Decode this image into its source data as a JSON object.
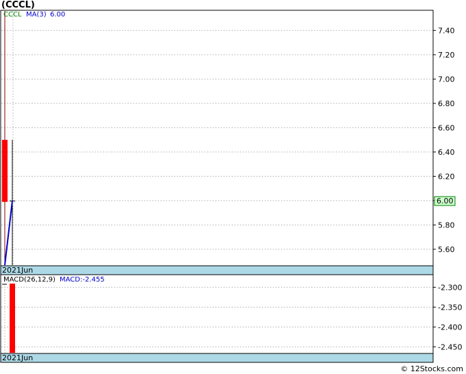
{
  "header": {
    "title": "(CCCL)"
  },
  "footer": {
    "credit": "© 12Stocks.com"
  },
  "colors": {
    "candle_down": "#ff0000",
    "ma_line": "#0000cc",
    "ticker_label": "#008000",
    "ma_label": "#0000cc",
    "macd_label": "#0000cc",
    "axis_band": "#add8e6",
    "grid": "#c0c0c0",
    "last_price_box": "#ccffcc"
  },
  "chart_data": [
    {
      "type": "candlestick",
      "legend": {
        "ticker": "CCCL",
        "ma_label": "MA(3)",
        "ma_value": "6.00"
      },
      "x_label": "2021Jun",
      "ylim": [
        5.47,
        7.56
      ],
      "y_ticks": [
        "5.60",
        "5.80",
        "6.00",
        "6.20",
        "6.40",
        "6.60",
        "6.80",
        "7.00",
        "7.20",
        "7.40"
      ],
      "grid": true,
      "last_price": "6.00",
      "candles": [
        {
          "open": 6.5,
          "close": 5.99,
          "high": 7.56,
          "low": 5.47
        },
        {
          "open": 6.0,
          "close": 6.0,
          "high": 6.5,
          "low": 5.47
        }
      ],
      "ma_line": [
        5.47,
        6.0
      ]
    },
    {
      "type": "bar",
      "legend": {
        "name": "MACD(26,12,9)",
        "value_label": "MACD:-2.455"
      },
      "x_label": "2021Jun",
      "ylim": [
        -2.465,
        -2.27
      ],
      "y_ticks": [
        "-2.300",
        "-2.350",
        "-2.400",
        "-2.450"
      ],
      "grid": true,
      "values": [
        -2.455
      ]
    }
  ]
}
